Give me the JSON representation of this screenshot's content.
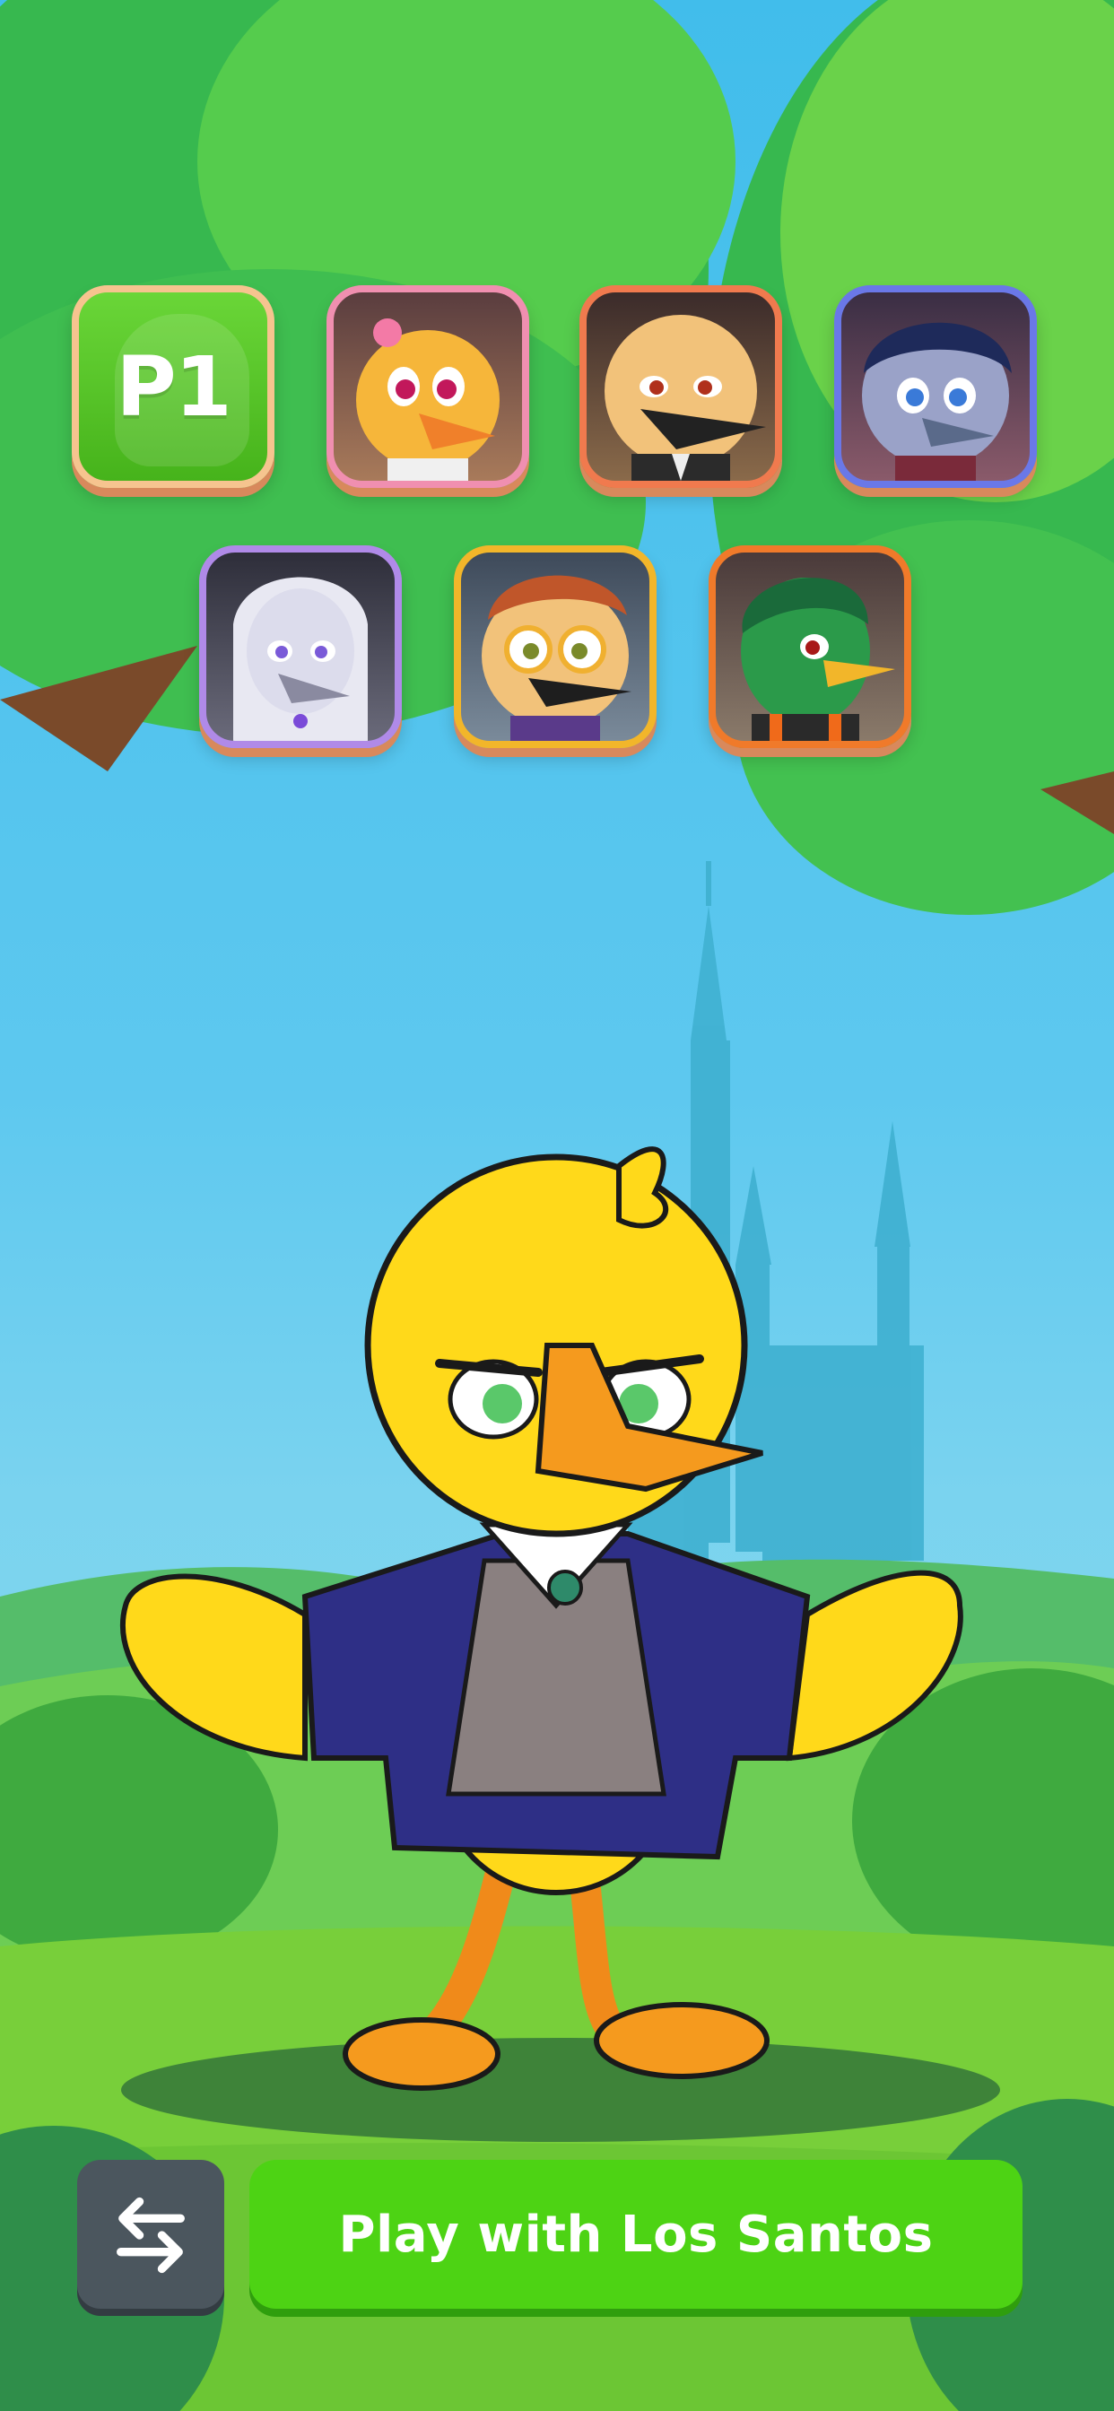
{
  "screen": "character-select",
  "player_slot": {
    "label": "P1"
  },
  "characters": [
    {
      "name": "pink-flower-duck",
      "frame_color": "#f08fb0",
      "feather": "#f6b63a"
    },
    {
      "name": "bald-duck",
      "frame_color": "#f07a4e",
      "feather": "#f2c27a"
    },
    {
      "name": "navy-hair-duck",
      "frame_color": "#6a78e8",
      "feather": "#9aa2c8"
    },
    {
      "name": "white-hair-duck",
      "frame_color": "#b08ae8",
      "feather": "#dcdcec"
    },
    {
      "name": "glasses-duck",
      "frame_color": "#f2b62a",
      "feather": "#f2c27a"
    },
    {
      "name": "mallard-duck",
      "frame_color": "#f07a2a",
      "feather": "#2b9a4a"
    }
  ],
  "featured_character": {
    "name": "yellow-duck-in-blazer",
    "body_color": "#ffd91a",
    "jacket_color": "#2e2f86"
  },
  "actions": {
    "swap_icon": "swap-arrows-icon",
    "play_label": "Play with Los Santos"
  },
  "colors": {
    "primary_green": "#4dd314",
    "dark_button": "#4b565e",
    "tile_border": "#f6c48f"
  }
}
